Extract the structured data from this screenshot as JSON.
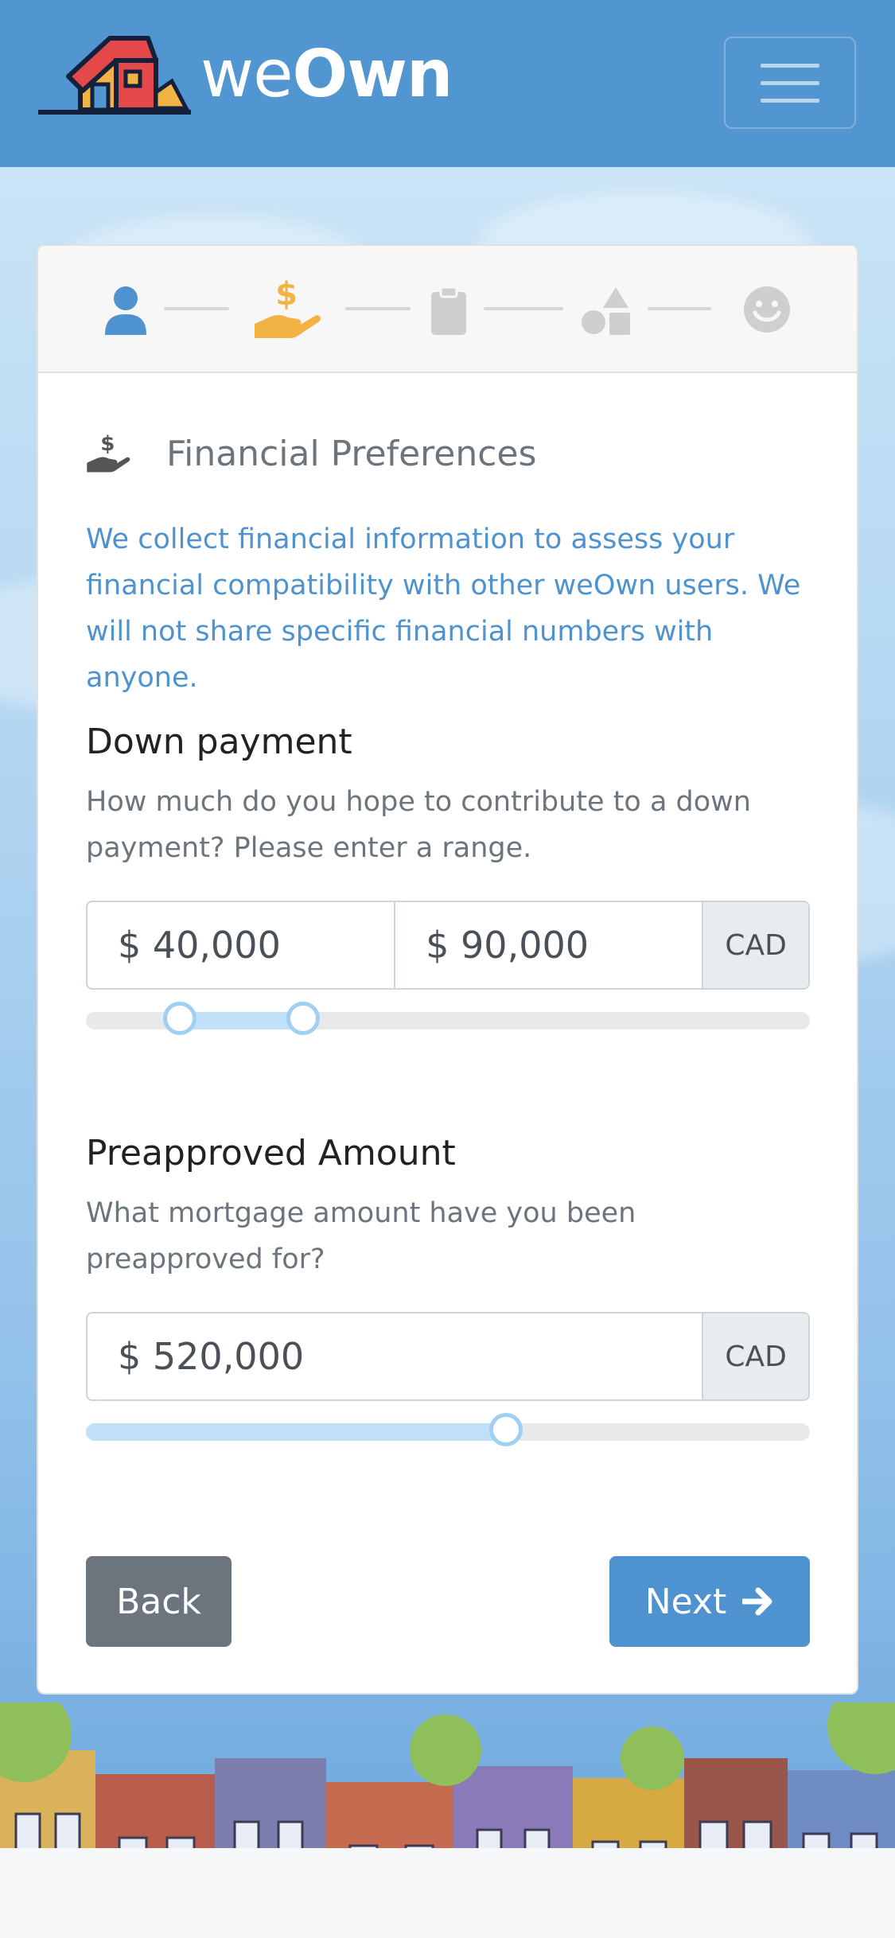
{
  "navbar": {
    "brand_we": "we",
    "brand_own": "Own",
    "logo_icon": "house-logo-icon",
    "menu_icon": "hamburger-menu-icon"
  },
  "stepper": {
    "steps": [
      {
        "icon": "user-icon",
        "state": "complete",
        "color": "#4e93cf"
      },
      {
        "icon": "hand-holding-dollar-icon",
        "state": "active",
        "color": "#f2b344"
      },
      {
        "icon": "clipboard-icon",
        "state": "inactive",
        "color": "#cfcfcf"
      },
      {
        "icon": "shapes-icon",
        "state": "inactive",
        "color": "#cfcfcf"
      },
      {
        "icon": "smile-icon",
        "state": "inactive",
        "color": "#cfcfcf"
      }
    ]
  },
  "section": {
    "title": "Financial Preferences",
    "icon": "hand-holding-dollar-icon",
    "intro": "We collect financial information to assess your financial compatibility with other weOwn users. We will not share specific financial numbers with anyone."
  },
  "down_payment": {
    "label": "Down payment",
    "help": "How much do you hope to contribute to a down payment? Please enter a range.",
    "min_value": "$ 40,000",
    "max_value": "$ 90,000",
    "currency": "CAD",
    "slider_low_fraction": 0.13,
    "slider_high_fraction": 0.3
  },
  "preapproved": {
    "label": "Preapproved Amount",
    "help": "What mortgage amount have you been preapproved for?",
    "value": "$ 520,000",
    "currency": "CAD",
    "slider_fraction": 0.58
  },
  "buttons": {
    "back_label": "Back",
    "next_label": "Next",
    "next_icon": "arrow-right-icon"
  },
  "colors": {
    "brand_blue": "#5296d1",
    "primary": "#4e93cf",
    "secondary": "#6c757d",
    "active_step": "#f2b344"
  }
}
